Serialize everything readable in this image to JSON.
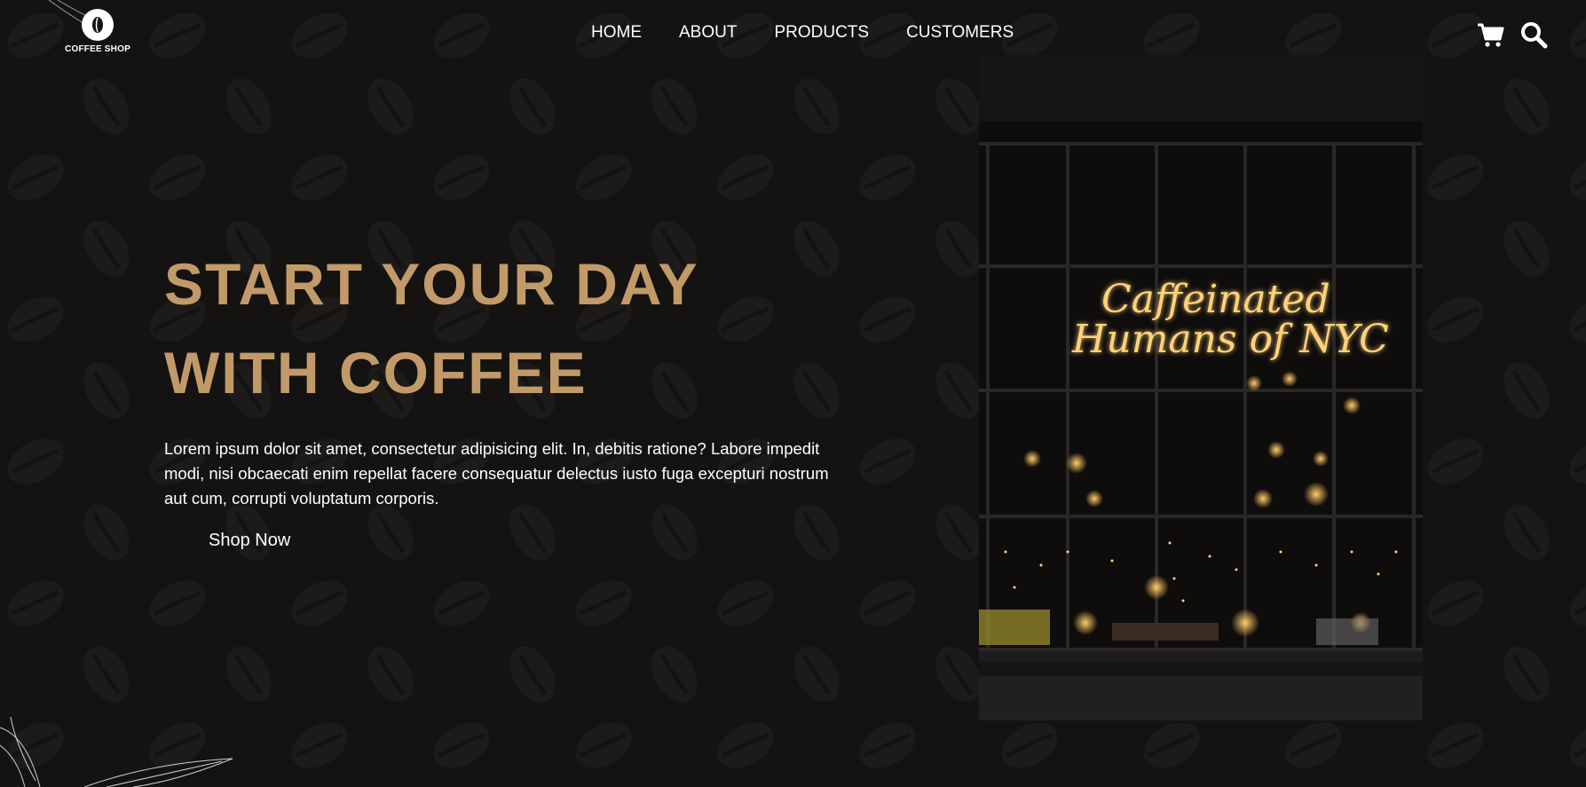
{
  "brand": {
    "name": "COFFEE SHOP",
    "logo_icon": "coffee-bean-logo-icon"
  },
  "nav": {
    "items": [
      "HOME",
      "ABOUT",
      "PRODUCTS",
      "CUSTOMERS"
    ]
  },
  "header_icons": [
    "cart-icon",
    "search-icon"
  ],
  "hero": {
    "title_line1": "START YOUR DAY",
    "title_line2": "WITH COFFEE",
    "description": "Lorem ipsum dolor sit amet, consectetur adipisicing elit. In, debitis ratione? Labore impedit modi, nisi obcaecati enim repellat facere consequatur delectus iusto fuga excepturi nostrum aut cum, corrupti voluptatum corporis.",
    "cta_label": "Shop Now"
  },
  "photo": {
    "neon_line1": "Caffeinated",
    "neon_line2": "Humans of NYC"
  },
  "colors": {
    "background": "#141312",
    "accent": "#c29a6a",
    "text": "#ffffff",
    "neon": "#ffcf6b"
  }
}
